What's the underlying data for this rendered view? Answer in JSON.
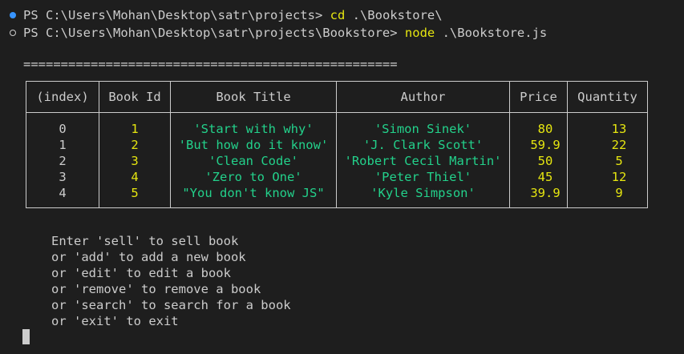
{
  "terminal": {
    "history": [
      {
        "prompt": "PS C:\\Users\\Mohan\\Desktop\\satr\\projects> ",
        "command": "cd",
        "args": " .\\Bookstore\\"
      },
      {
        "prompt": "PS C:\\Users\\Mohan\\Desktop\\satr\\projects\\Bookstore> ",
        "command": "node",
        "args": " .\\Bookstore.js"
      }
    ],
    "separator": "=================================================="
  },
  "table": {
    "headers": [
      "(index)",
      "Book Id",
      "Book Title",
      "Author",
      "Price",
      "Quantity"
    ],
    "rows": [
      {
        "index": "0",
        "id": "1",
        "title": "'Start with why'",
        "author": "'Simon Sinek'",
        "price": "80",
        "qty": "13"
      },
      {
        "index": "1",
        "id": "2",
        "title": "'But how do it know'",
        "author": "'J. Clark Scott'",
        "price": "59.9",
        "qty": "22"
      },
      {
        "index": "2",
        "id": "3",
        "title": "'Clean Code'",
        "author": "'Robert Cecil Martin'",
        "price": "50",
        "qty": "5"
      },
      {
        "index": "3",
        "id": "4",
        "title": "'Zero to One'",
        "author": "'Peter Thiel'",
        "price": "45",
        "qty": "12"
      },
      {
        "index": "4",
        "id": "5",
        "title": "\"You don't know JS\"",
        "author": "'Kyle Simpson'",
        "price": "39.9",
        "qty": "9"
      }
    ]
  },
  "menu": [
    "Enter 'sell' to sell book",
    "or 'add' to add a new book",
    "or 'edit' to edit a book",
    "or 'remove' to remove a book",
    "or 'search' to search for a book",
    "or 'exit' to exit"
  ],
  "colors": {
    "background": "#1e1e1e",
    "text": "#cccccc",
    "command": "#e5e510",
    "string": "#23d18b",
    "number": "#e5e510",
    "success_marker": "#3794ff"
  }
}
